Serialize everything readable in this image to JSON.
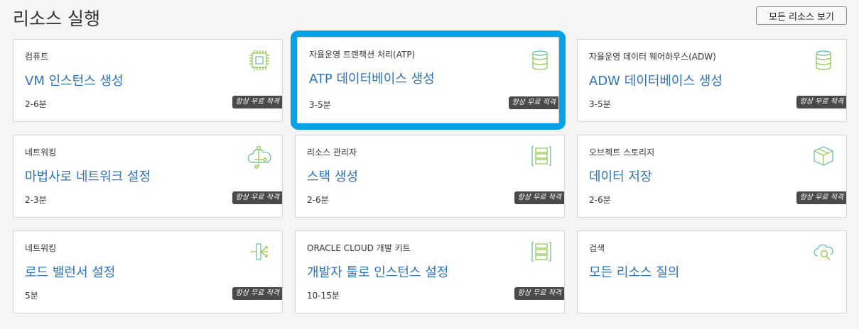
{
  "header": {
    "title": "리소스 실행",
    "view_all_label": "모든 리소스 보기"
  },
  "cards": [
    {
      "category": "컴퓨트",
      "title": "VM 인스턴스 생성",
      "duration": "2-6분",
      "badge": "항상 무료 적격",
      "icon": "chip-icon"
    },
    {
      "category": "자율운영 트랜잭션 처리(ATP)",
      "title": "ATP 데이터베이스 생성",
      "duration": "3-5분",
      "badge": "항상 무료 적격",
      "icon": "database-icon"
    },
    {
      "category": "자율운영 데이터 웨어하우스(ADW)",
      "title": "ADW 데이터베이스 생성",
      "duration": "3-5분",
      "badge": "항상 무료 적격",
      "icon": "database-icon"
    },
    {
      "category": "네트워킹",
      "title": "마법사로 네트워크 설정",
      "duration": "2-3분",
      "badge": "항상 무료 적격",
      "icon": "cloud-network-icon"
    },
    {
      "category": "리소스 관리자",
      "title": "스택 생성",
      "duration": "2-6분",
      "badge": "항상 무료 적격",
      "icon": "stack-icon"
    },
    {
      "category": "오브젝트 스토리지",
      "title": "데이터 저장",
      "duration": "2-6분",
      "badge": "항상 무료 적격",
      "icon": "box-icon"
    },
    {
      "category": "네트워킹",
      "title": "로드 밸런서 설정",
      "duration": "5분",
      "badge": "항상 무료 적격",
      "icon": "load-balancer-icon"
    },
    {
      "category": "ORACLE CLOUD 개발 키트",
      "title": "개발자 툴로 인스턴스 설정",
      "duration": "10-15분",
      "badge": "항상 무료 적격",
      "icon": "stack-icon"
    },
    {
      "category": "검색",
      "title": "모든 리소스 질의",
      "duration": "",
      "badge": "",
      "icon": "cloud-search-icon"
    }
  ],
  "colors": {
    "accent": "#2f73b5",
    "selection": "#00a3e8",
    "icon_green": "#8cc63f",
    "icon_teal": "#5fb8b0"
  }
}
